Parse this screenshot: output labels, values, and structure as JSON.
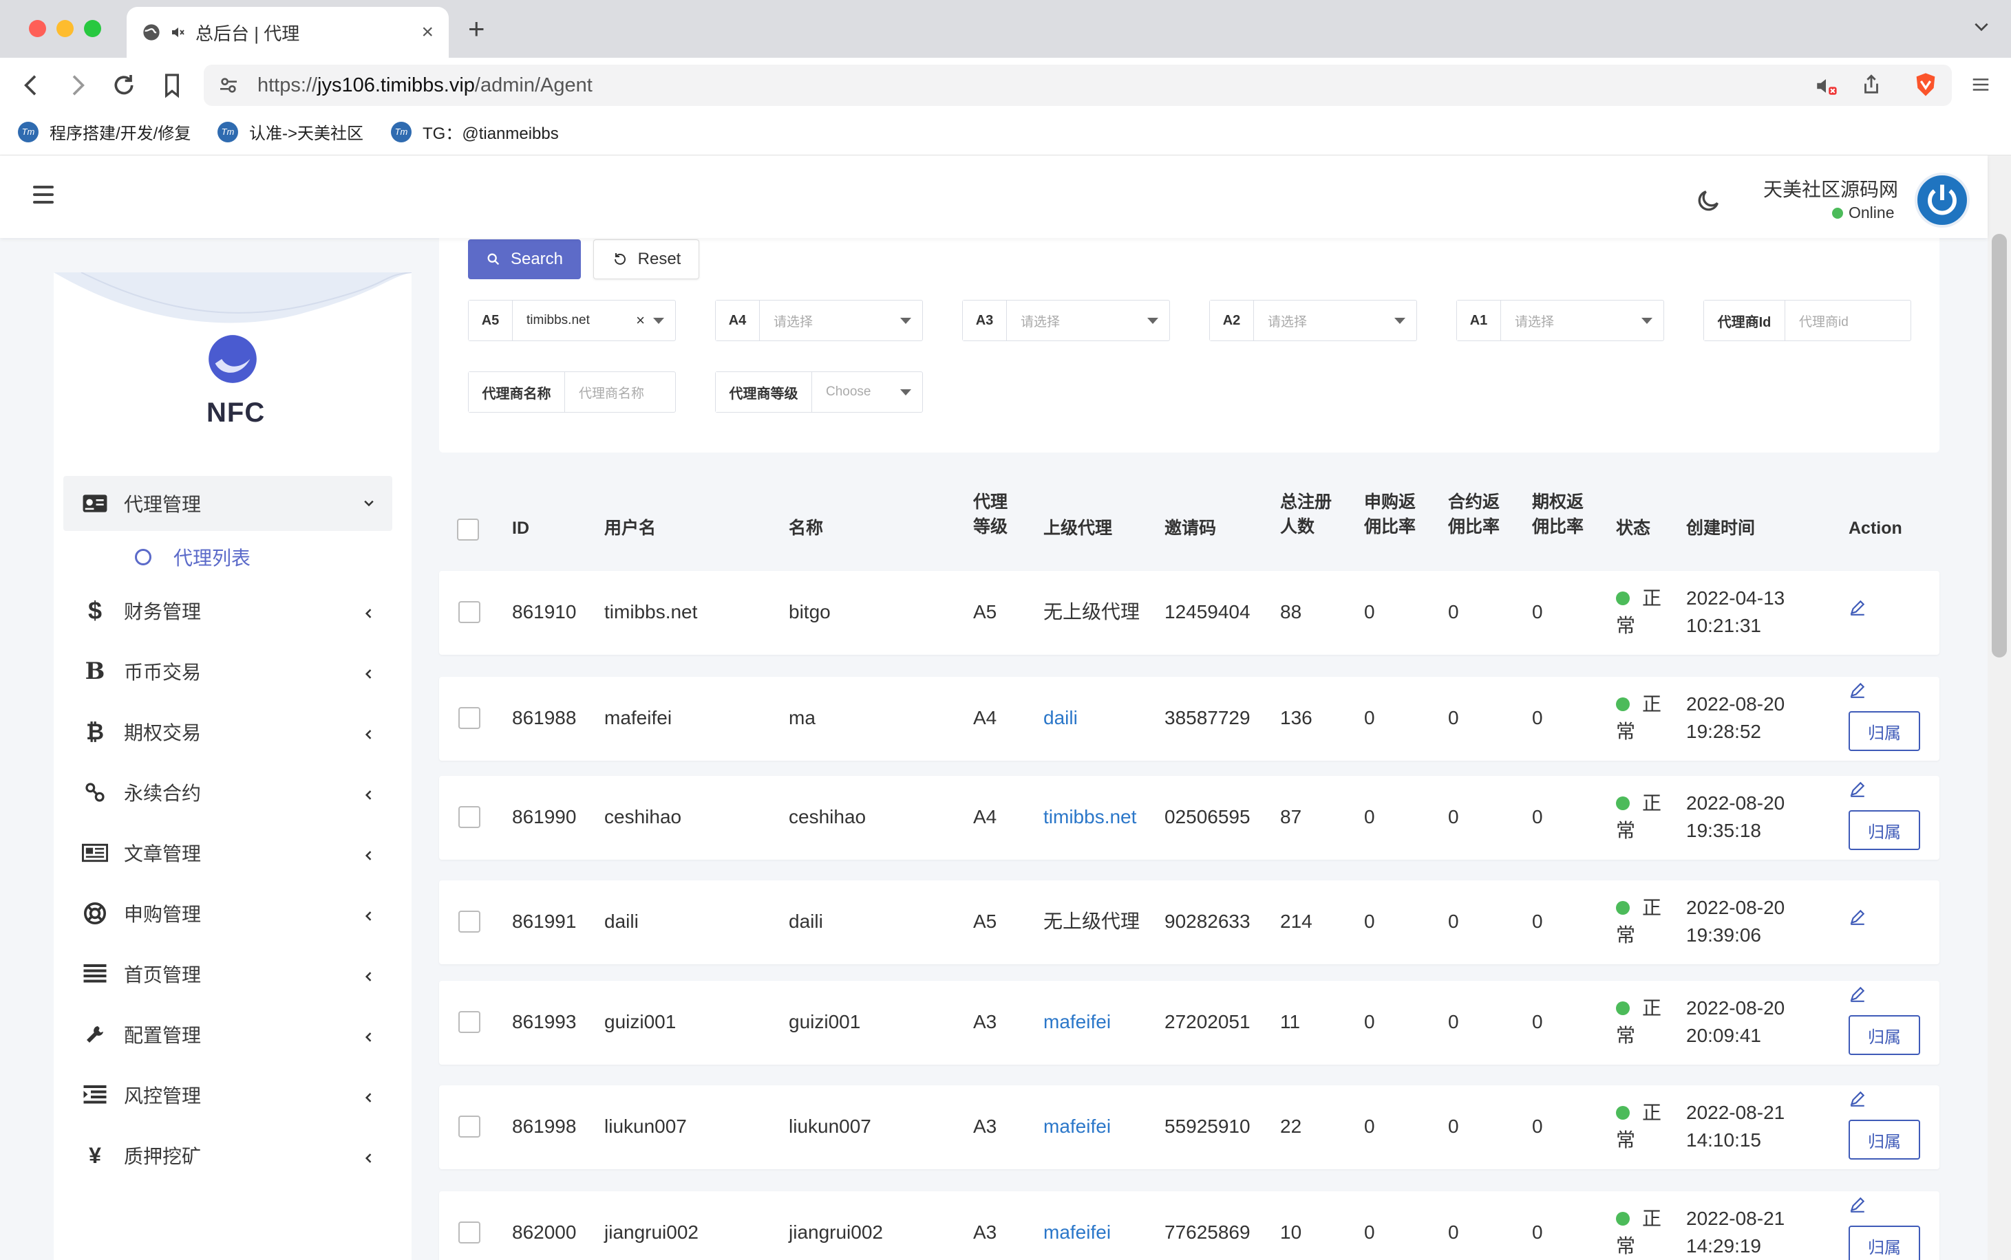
{
  "browser": {
    "tab_title": "总后台 | 代理",
    "url_prefix": "https://",
    "url_host": "jys106.timibbs.vip",
    "url_path": "/admin/Agent",
    "bookmarks": [
      "程序搭建/开发/修复",
      "认准->天美社区",
      "TG：@tianmeibbs"
    ],
    "favicon_text": "Tm"
  },
  "header": {
    "user_name": "天美社区源码网",
    "user_status": "Online"
  },
  "sidebar": {
    "brand": "NFC",
    "active_group": "代理管理",
    "active_sub": "代理列表",
    "items": [
      {
        "label": "财务管理",
        "icon": "dollar-icon",
        "glyph": "$"
      },
      {
        "label": "币币交易",
        "icon": "bitcoin-b-icon",
        "glyph": "B"
      },
      {
        "label": "期权交易",
        "icon": "bitcoin-icon",
        "glyph": "₿"
      },
      {
        "label": "永续合约",
        "icon": "link-icon",
        "glyph": "⚯"
      },
      {
        "label": "文章管理",
        "icon": "newspaper-icon",
        "glyph": "▤"
      },
      {
        "label": "申购管理",
        "icon": "lifebuoy-icon",
        "glyph": "⊕"
      },
      {
        "label": "首页管理",
        "icon": "list-icon",
        "glyph": "≣"
      },
      {
        "label": "配置管理",
        "icon": "wrench-icon",
        "glyph": "🔧"
      },
      {
        "label": "风控管理",
        "icon": "indent-icon",
        "glyph": "☰"
      },
      {
        "label": "质押挖矿",
        "icon": "yen-icon",
        "glyph": "¥"
      }
    ]
  },
  "filters": {
    "search_label": "Search",
    "reset_label": "Reset",
    "fields": [
      {
        "label": "A5",
        "value": "timibbs.net",
        "set": true
      },
      {
        "label": "A4",
        "value": "请选择",
        "set": false
      },
      {
        "label": "A3",
        "value": "请选择",
        "set": false
      },
      {
        "label": "A2",
        "value": "请选择",
        "set": false
      },
      {
        "label": "A1",
        "value": "请选择",
        "set": false
      },
      {
        "label": "代理商Id",
        "value": "代理商id",
        "set": false
      },
      {
        "label": "代理商名称",
        "value": "代理商名称",
        "set": false
      },
      {
        "label": "代理商等级",
        "value": "Choose",
        "set": false
      }
    ]
  },
  "table": {
    "headers": {
      "id": "ID",
      "username": "用户名",
      "name": "名称",
      "level_1": "代理",
      "level_2": "等级",
      "parent": "上级代理",
      "invite": "邀请码",
      "total_1": "总注册",
      "total_2": "人数",
      "sub_1": "申购返",
      "sub_2": "佣比率",
      "contract_1": "合约返",
      "contract_2": "佣比率",
      "option_1": "期权返",
      "option_2": "佣比率",
      "status": "状态",
      "created": "创建时间",
      "action": "Action"
    },
    "belong_label": "归属",
    "rows": [
      {
        "id": "861910",
        "username": "timibbs.net",
        "name": "bitgo",
        "level": "A5",
        "parent": "无上级代理",
        "parent_link": false,
        "invite": "12459404",
        "total": "88",
        "sub": "0",
        "contract": "0",
        "option": "0",
        "status_1": "正",
        "status_2": "常",
        "date": "2022-04-13",
        "time": "10:21:31",
        "belong": false
      },
      {
        "id": "861988",
        "username": "mafeifei",
        "name": "ma",
        "level": "A4",
        "parent": "daili",
        "parent_link": true,
        "invite": "38587729",
        "total": "136",
        "sub": "0",
        "contract": "0",
        "option": "0",
        "status_1": "正",
        "status_2": "常",
        "date": "2022-08-20",
        "time": "19:28:52",
        "belong": true
      },
      {
        "id": "861990",
        "username": "ceshihao",
        "name": "ceshihao",
        "level": "A4",
        "parent": "timibbs.net",
        "parent_link": true,
        "invite": "02506595",
        "total": "87",
        "sub": "0",
        "contract": "0",
        "option": "0",
        "status_1": "正",
        "status_2": "常",
        "date": "2022-08-20",
        "time": "19:35:18",
        "belong": true
      },
      {
        "id": "861991",
        "username": "daili",
        "name": "daili",
        "level": "A5",
        "parent": "无上级代理",
        "parent_link": false,
        "invite": "90282633",
        "total": "214",
        "sub": "0",
        "contract": "0",
        "option": "0",
        "status_1": "正",
        "status_2": "常",
        "date": "2022-08-20",
        "time": "19:39:06",
        "belong": false
      },
      {
        "id": "861993",
        "username": "guizi001",
        "name": "guizi001",
        "level": "A3",
        "parent": "mafeifei",
        "parent_link": true,
        "invite": "27202051",
        "total": "11",
        "sub": "0",
        "contract": "0",
        "option": "0",
        "status_1": "正",
        "status_2": "常",
        "date": "2022-08-20",
        "time": "20:09:41",
        "belong": true
      },
      {
        "id": "861998",
        "username": "liukun007",
        "name": "liukun007",
        "level": "A3",
        "parent": "mafeifei",
        "parent_link": true,
        "invite": "55925910",
        "total": "22",
        "sub": "0",
        "contract": "0",
        "option": "0",
        "status_1": "正",
        "status_2": "常",
        "date": "2022-08-21",
        "time": "14:10:15",
        "belong": true
      },
      {
        "id": "862000",
        "username": "jiangrui002",
        "name": "jiangrui002",
        "level": "A3",
        "parent": "mafeifei",
        "parent_link": true,
        "invite": "77625869",
        "total": "10",
        "sub": "0",
        "contract": "0",
        "option": "0",
        "status_1": "正",
        "status_2": "常",
        "date": "2022-08-21",
        "time": "14:29:19",
        "belong": true
      }
    ]
  },
  "colors": {
    "primary": "#5d6bc8",
    "link": "#2b77c9",
    "status_ok": "#4cbb5a",
    "belong_border": "#3f5bb8"
  }
}
